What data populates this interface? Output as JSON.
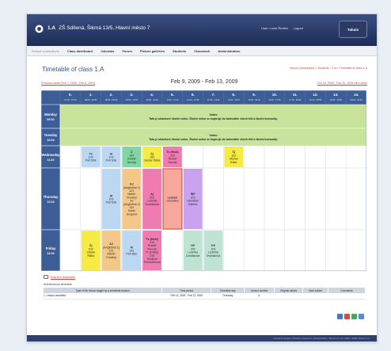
{
  "header": {
    "title_bold": "1.A",
    "title_rest": "ZŠ Sdílená, Šikmá 13/5, Hlavní město 7",
    "user": "User: Lucie Řezlitá",
    "logout": "Logout",
    "brand": "Tahuis"
  },
  "menu": [
    "School connections",
    "Class dashboard",
    "Calendar",
    "Forum",
    "Picture galleries",
    "Students",
    "Classwork",
    "Administration"
  ],
  "page": {
    "title": "Timetable of class 1.A",
    "breadcrumb": "School connections > Students > 1.A > Timetable of class 1.A"
  },
  "weeknav": {
    "prev": "Previous week (Feb 2, 2009 - Feb 6, 2009)",
    "current": "Feb 9, 2009 - Feb 13, 2009",
    "next": "Feb 16, 2009 - Feb 20, 2009 Next week"
  },
  "timetable": {
    "periods": [
      {
        "n": "0.",
        "t": "07:00 - 07:45"
      },
      {
        "n": "1.",
        "t": "08:00 - 08:45"
      },
      {
        "n": "2.",
        "t": "08:55 - 09:40"
      },
      {
        "n": "3.",
        "t": "09:50 - 10:35"
      },
      {
        "n": "4.",
        "t": "10:50 - 11:35"
      },
      {
        "n": "5.",
        "t": "11:45 - 12:30"
      },
      {
        "n": "6.",
        "t": "12:40 - 13:25"
      },
      {
        "n": "7.",
        "t": "13:35 - 14:20"
      },
      {
        "n": "8.",
        "t": "14:30 - 15:15"
      },
      {
        "n": "9.",
        "t": "15:25 - 16:10"
      },
      {
        "n": "10.",
        "t": "16:20 - 17:05"
      },
      {
        "n": "11.",
        "t": "17:15 - 18:00"
      },
      {
        "n": "12.",
        "t": "18:10 - 18:55"
      },
      {
        "n": "13.",
        "t": "19:05 - 19:50"
      },
      {
        "n": "14.",
        "t": "20:00 - 20:45"
      }
    ],
    "days": [
      {
        "name": "Monday",
        "date": "09.02"
      },
      {
        "name": "Tuesday",
        "date": "10.02"
      },
      {
        "name": "Wednesday",
        "date": "11.02"
      },
      {
        "name": "Thursday",
        "date": "12.02"
      },
      {
        "name": "Friday",
        "date": "13.02"
      }
    ],
    "holiday_title": "Volno",
    "holiday_text": "Tato je ukázkové školní volno. Školní volno se kopíruje do kalendáře všech tříd a školní komunity.",
    "lessons": [
      {
        "day": 2,
        "col": 1,
        "span": 1,
        "rows": [
          0,
          1
        ],
        "color": "#bcd7f2",
        "lines": [
          "Tč",
          "102",
          "Petr Bílé"
        ]
      },
      {
        "day": 2,
        "col": 2,
        "span": 1,
        "rows": [
          0,
          1
        ],
        "color": "#bcd7f2",
        "lines": [
          "M",
          "103",
          "Petr Bílé"
        ]
      },
      {
        "day": 2,
        "col": 3,
        "span": 1,
        "rows": [
          0,
          1
        ],
        "color": "#7fd6a3",
        "lines": [
          "Z",
          "104",
          "Rudolf",
          "Novotý"
        ]
      },
      {
        "day": 2,
        "col": 4,
        "span": 1,
        "rows": [
          0,
          1
        ],
        "color": "#f6ea44",
        "lines": [
          "Čj",
          "102",
          "Václav Šiška"
        ]
      },
      {
        "day": 2,
        "col": 5,
        "span": 1,
        "rows": [
          0,
          1
        ],
        "color": "#ef7bb0",
        "lines": [
          "Tv (Hoši)",
          "210",
          "Rudolf",
          "Novotý"
        ]
      },
      {
        "day": 2,
        "col": 8,
        "span": 1,
        "rows": [
          0,
          1
        ],
        "color": "#f6ea44",
        "lines": [
          "Čj",
          "102",
          "Michal",
          "Bílek"
        ]
      },
      {
        "day": 3,
        "col": 2,
        "span": 1,
        "rows": [
          0,
          1
        ],
        "color": "#bcd7f2",
        "lines": [
          "M",
          "103",
          "Petr Bílé"
        ]
      },
      {
        "day": 3,
        "col": 3,
        "span": 1,
        "rows": [
          0,
          1
        ],
        "color": "#f3c788",
        "lines": [
          "AJ",
          "(Angličtina 1)",
          "121",
          "Martin",
          "Chvalný",
          "AJ",
          "(Angličtina 2)",
          "124",
          "Karla",
          "Svrgová"
        ]
      },
      {
        "day": 3,
        "col": 4,
        "span": 1,
        "rows": [
          0,
          1
        ],
        "color": "#ef7bb0",
        "lines": [
          "Aj",
          "202",
          "Ludmila",
          "Dvořáková"
        ]
      },
      {
        "day": 3,
        "col": 5,
        "span": 1,
        "rows": [
          0,
          1
        ],
        "color": "#f8a79c",
        "lines": [
          "Lesson",
          "cancelled"
        ],
        "cancelled": true
      },
      {
        "day": 3,
        "col": 6,
        "span": 1,
        "rows": [
          0,
          1
        ],
        "color": "#c9a3f0",
        "lines": [
          "INF",
          "202",
          "Stanislav",
          "Kalivos"
        ]
      },
      {
        "day": 4,
        "col": 1,
        "span": 1,
        "rows": [
          0,
          1
        ],
        "color": "#f6ea44",
        "lines": [
          "Čj",
          "102",
          "Václav",
          "Šiška"
        ]
      },
      {
        "day": 4,
        "col": 2,
        "span": 1,
        "rows": [
          0,
          1
        ],
        "color": "#f3c788",
        "lines": [
          "AJ",
          "(Angličtina 1)",
          "121",
          "Martin",
          "Chvalný"
        ]
      },
      {
        "day": 4,
        "col": 3,
        "span": 1,
        "rows": [
          0,
          1
        ],
        "color": "#bcd7f2",
        "lines": [
          "M",
          "103",
          "Petr Bílé"
        ]
      },
      {
        "day": 4,
        "col": 4,
        "span": 1,
        "rows": [
          0,
          1
        ],
        "color": "#ef7bb0",
        "lines": [
          "Tv (Hoši)",
          "210",
          "Rudolf",
          "Novotý",
          "Tv (Dívky)",
          "210",
          "Kristýna",
          "Procházková"
        ]
      },
      {
        "day": 4,
        "col": 6,
        "span": 1,
        "rows": [
          0,
          1
        ],
        "color": "#bfe3d3",
        "lines": [
          "HV",
          "202",
          "Ludmila",
          "Dvořáková"
        ]
      },
      {
        "day": 4,
        "col": 7,
        "span": 1,
        "rows": [
          0,
          1
        ],
        "color": "#bfe3d3",
        "lines": [
          "HV",
          "202",
          "Ludmila",
          "Dvořáková"
        ]
      }
    ]
  },
  "edit_link": "Edit the timetable",
  "substitutions": {
    "title": "Substitutions timetable",
    "headers": [
      "Type of the lesson taught by a substitute teacher",
      "Time period",
      "Timetable day",
      "Lesson number",
      "Original values",
      "New values",
      "Comments"
    ],
    "rows": [
      [
        "1. Lesson cancelled",
        "Feb 12, 2009 - Feb 12, 2009",
        "Thursday",
        "5.",
        "",
        "",
        ""
      ]
    ]
  },
  "footer": "Contacts support | Privacy protection | Accessibility | Tahuis.cz | (C) 2008 - 2009 Tahuis s.r.o."
}
